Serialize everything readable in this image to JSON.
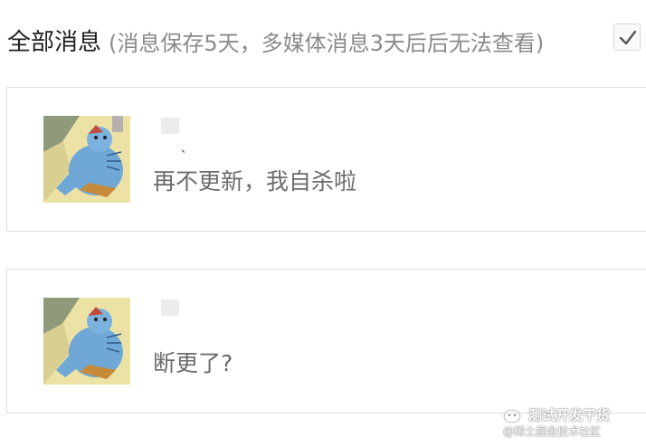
{
  "header": {
    "title": "全部消息",
    "subtitle": "(消息保存5天，多媒体消息3天后后无法查看)"
  },
  "messages": [
    {
      "name": "",
      "separator": "、",
      "text": "再不更新，我自杀啦"
    },
    {
      "name": "",
      "separator": "",
      "text": "断更了?"
    }
  ],
  "watermark": {
    "line1": "测试开发干货",
    "line2": "@稀土掘金技术社区"
  },
  "colors": {
    "title": "#1f1f1f",
    "subtitle": "#8a8a8a",
    "message": "#6b6b6b",
    "border": "#dcdcdc"
  }
}
